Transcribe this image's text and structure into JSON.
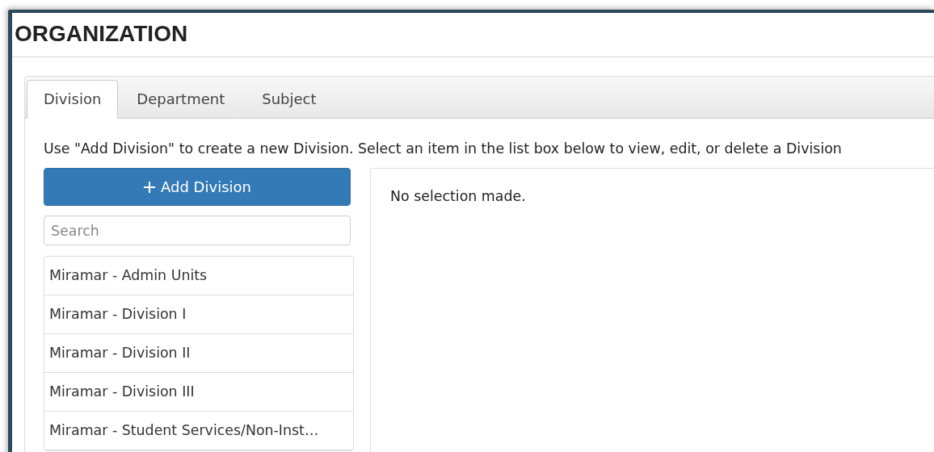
{
  "page": {
    "title": "ORGANIZATION"
  },
  "tabs": [
    {
      "label": "Division",
      "selected": true
    },
    {
      "label": "Department",
      "selected": false
    },
    {
      "label": "Subject",
      "selected": false
    }
  ],
  "instructions": "Use \"Add Division\" to create a new Division. Select an item in the list box below to view, edit, or delete a Division",
  "add_button": {
    "label": "Add Division"
  },
  "search": {
    "placeholder": "Search"
  },
  "divisions": [
    {
      "label": "Miramar - Admin Units",
      "selected": false
    },
    {
      "label": "Miramar - Division I",
      "selected": false
    },
    {
      "label": "Miramar - Division II",
      "selected": false
    },
    {
      "label": "Miramar - Division III",
      "selected": false
    },
    {
      "label": "Miramar - Student Services/Non-Inst…",
      "selected": false
    }
  ],
  "detail": {
    "message": "No selection made."
  }
}
